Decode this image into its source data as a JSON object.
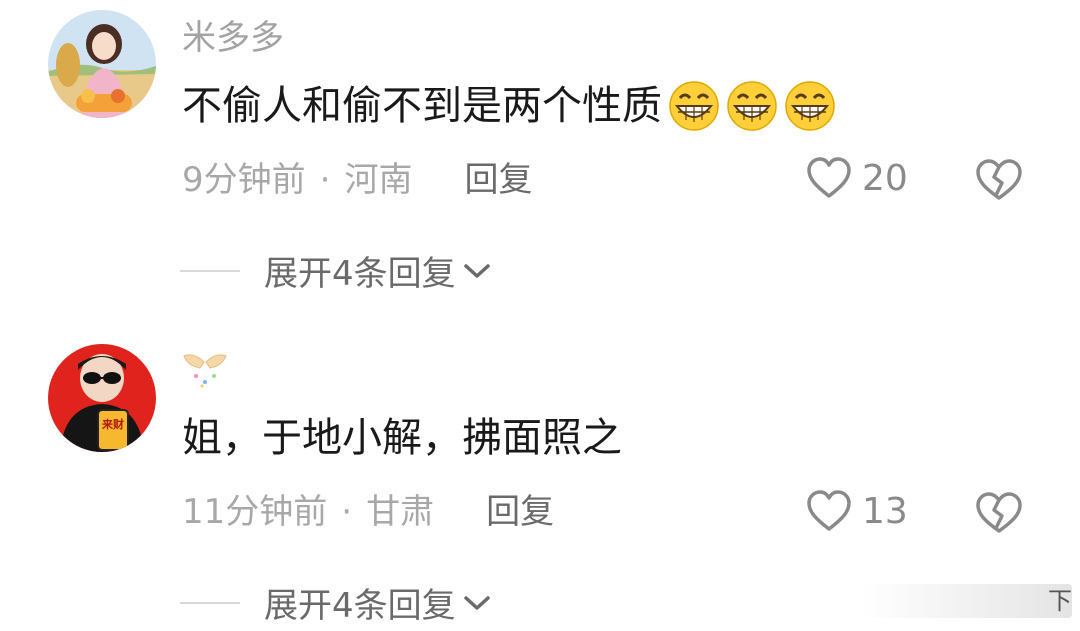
{
  "comments": [
    {
      "username": "米多多",
      "text": "不偷人和偷不到是两个性质",
      "emoji_count": 3,
      "emoji_name": "grinning-face-emoji",
      "time": "9分钟前",
      "dot": "·",
      "location": "河南",
      "reply_label": "回复",
      "likes": "20",
      "expand_label": "展开4条回复"
    },
    {
      "username": "",
      "text": "姐，于地小解，拂面照之",
      "time": "11分钟前",
      "dot": "·",
      "location": "甘肃",
      "reply_label": "回复",
      "likes": "13",
      "expand_label": "展开4条回复",
      "avatar_phone_text": "来财"
    }
  ],
  "watermark": "下",
  "colors": {
    "username": "#a3a3a3",
    "text": "#1a1a1a",
    "meta": "#a8a8a8",
    "action": "#6a6a6a"
  }
}
